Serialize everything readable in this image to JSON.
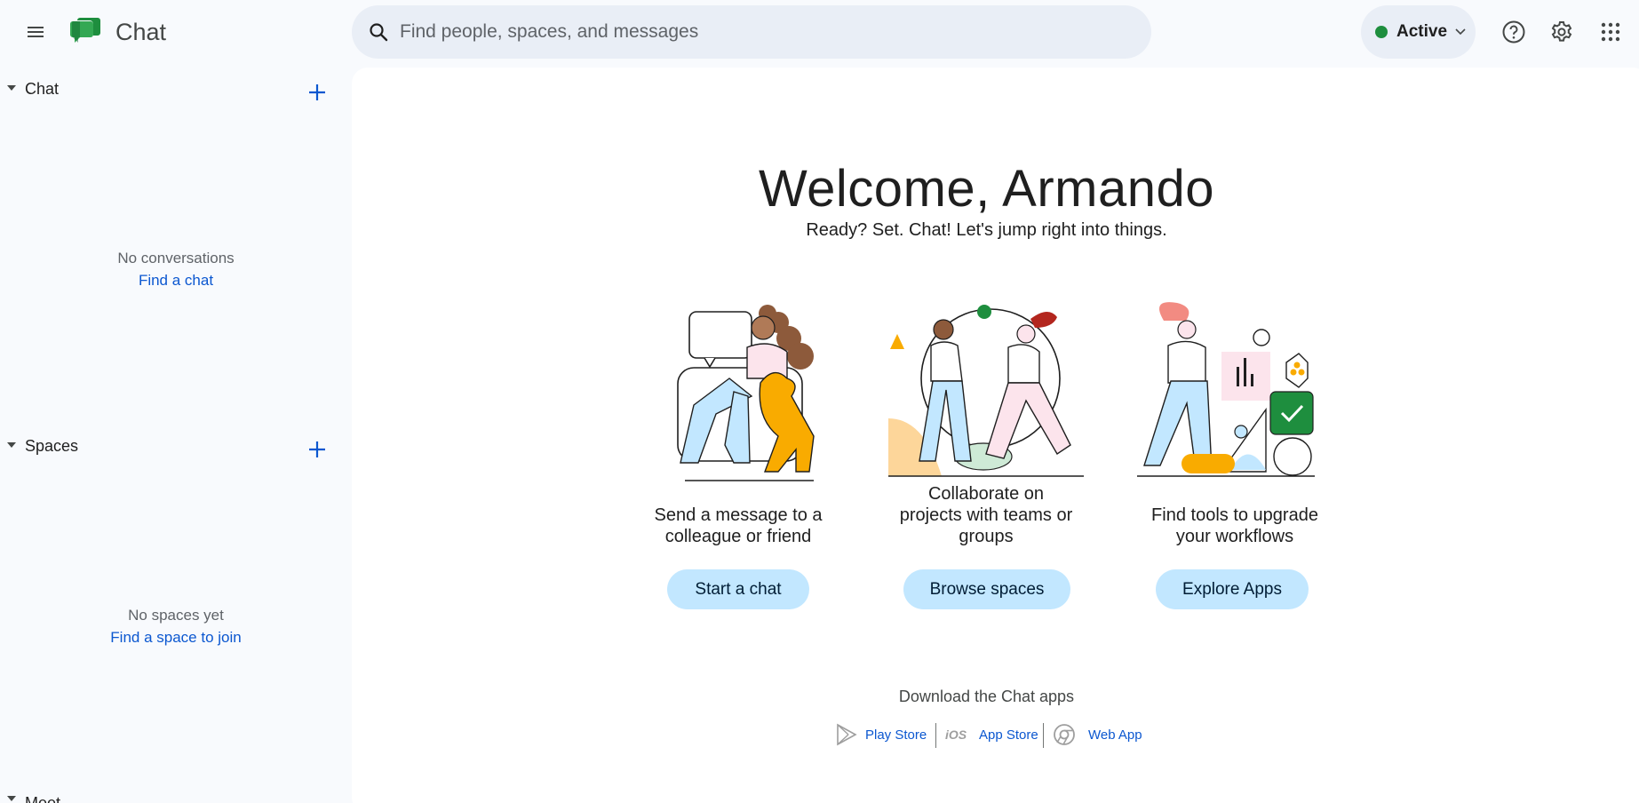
{
  "header": {
    "app_title": "Chat",
    "search": {
      "placeholder": "Find people, spaces, and messages",
      "value": ""
    },
    "status": {
      "label": "Active",
      "color": "#1e8e3e"
    },
    "icons": [
      "menu-icon",
      "chat-logo-icon",
      "search-icon",
      "help-icon",
      "settings-icon",
      "apps-grid-icon"
    ]
  },
  "sidebar": {
    "chat_section": {
      "title": "Chat",
      "empty_message": "No conversations",
      "empty_link": "Find a chat"
    },
    "spaces_section": {
      "title": "Spaces",
      "empty_message": "No spaces yet",
      "empty_link": "Find a space to join"
    },
    "meet_section": {
      "title": "Meet"
    }
  },
  "main": {
    "welcome_title": "Welcome, Armando",
    "subtitle": "Ready? Set. Chat! Let's jump right into things.",
    "cards": [
      {
        "line1": "Send a message to a",
        "line2": "colleague or friend",
        "button": "Start a chat"
      },
      {
        "line1": "Collaborate on",
        "line2": "projects with teams or",
        "line3": "groups",
        "button": "Browse spaces"
      },
      {
        "line1": "Find tools to upgrade",
        "line2": "your workflows",
        "button": "Explore Apps"
      }
    ],
    "downloads": {
      "title": "Download the Chat apps",
      "items": [
        {
          "label": "Play Store",
          "icon": "play-store-icon"
        },
        {
          "label": "App Store",
          "icon": "ios-icon",
          "icon_text": "iOS"
        },
        {
          "label": "Web App",
          "icon": "chrome-icon"
        }
      ]
    }
  },
  "colors": {
    "accent": "#0b57d0",
    "button_bg": "#c2e7ff",
    "search_bg": "#e9eef6",
    "page_bg": "#f8fafd"
  }
}
